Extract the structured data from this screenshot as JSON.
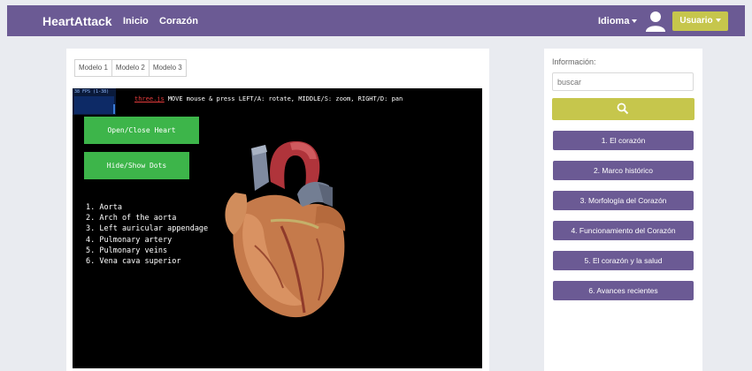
{
  "navbar": {
    "brand": "HeartAttack",
    "links": [
      "Inicio",
      "Corazón"
    ],
    "language_label": "Idioma",
    "user_label": "Usuario"
  },
  "model_tabs": [
    "Modelo 1",
    "Modelo 2",
    "Modelo 3"
  ],
  "viewer": {
    "fps_label": "38 FPS (1-38)",
    "instruction_link": "three.js",
    "instruction_text": "MOVE mouse & press LEFT/A: rotate, MIDDLE/S: zoom, RIGHT/D: pan",
    "open_close_label": "Open/Close Heart",
    "hide_show_label": "Hide/Show Dots",
    "parts": [
      "1. Aorta",
      "2. Arch of the aorta",
      "3. Left auricular appendage",
      "4. Pulmonary artery",
      "5. Pulmonary veins",
      "6. Vena cava superior"
    ]
  },
  "sidebar": {
    "info_label": "Información:",
    "search_placeholder": "buscar",
    "search_icon": "search-icon",
    "items": [
      "1. El corazón",
      "2. Marco histórico",
      "3. Morfología del Corazón",
      "4. Funcionamiento del Corazón",
      "5. El corazón y la salud",
      "6. Avances recientes"
    ]
  },
  "colors": {
    "navbar": "#6b5a94",
    "accent": "#c6c64c",
    "green_button": "#3db54a"
  }
}
